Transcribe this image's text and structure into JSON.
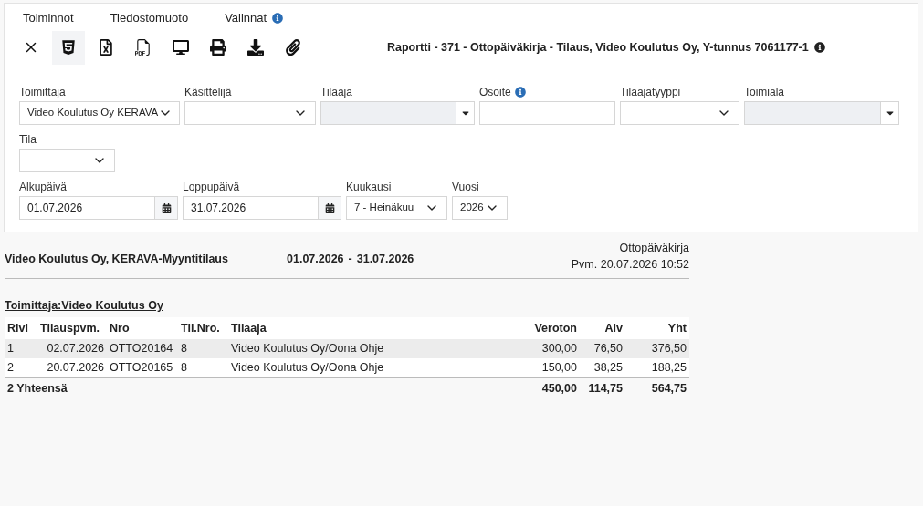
{
  "menu": [
    {
      "label": "Toiminnot",
      "info": false
    },
    {
      "label": "Tiedostomuoto",
      "info": false
    },
    {
      "label": "Valinnat",
      "info": true
    }
  ],
  "toolbar": [
    {
      "kind": "close",
      "selected": false
    },
    {
      "kind": "html",
      "selected": true
    },
    {
      "kind": "excel",
      "selected": false
    },
    {
      "kind": "pdf",
      "selected": false
    },
    {
      "kind": "screen",
      "selected": false
    },
    {
      "kind": "print",
      "selected": false
    },
    {
      "kind": "download",
      "selected": false
    },
    {
      "kind": "attach",
      "selected": false
    }
  ],
  "report_title": "Raportti - 371 - Ottopäiväkirja - Tilaus, Video Koulutus Oy, Y-tunnus 7061177-1",
  "filter_rows": [
    [
      {
        "label": "Toimittaja",
        "kind": "select",
        "value": "Video Koulutus Oy KERAVA",
        "info": false
      },
      {
        "label": "Käsittelijä",
        "kind": "select",
        "info": false
      },
      {
        "label": "Tilaaja",
        "kind": "combo",
        "info": false
      },
      {
        "label": "Osoite",
        "kind": "text",
        "info": true
      },
      {
        "label": "Tilaajatyyppi",
        "kind": "select",
        "info": false
      },
      {
        "label": "Toimiala",
        "kind": "combo",
        "info": false
      }
    ],
    [
      {
        "label": "Tila",
        "kind": "select",
        "info": false
      }
    ],
    [
      {
        "label": "Alkupäivä",
        "kind": "date",
        "value": "01.07.2026",
        "info": false
      },
      {
        "label": "Loppupäivä",
        "kind": "date",
        "value": "31.07.2026",
        "info": false
      },
      {
        "label": "Kuukausi",
        "kind": "select",
        "value": "7 - Heinäkuu",
        "info": false
      },
      {
        "label": "Vuosi",
        "kind": "select",
        "value": "2026",
        "info": false
      }
    ]
  ],
  "report": {
    "heading": "Video Koulutus Oy, KERAVA-Myyntitilaus",
    "period_start": "01.07.2026",
    "period_separator": "-",
    "period_end": "31.07.2026",
    "name": "Ottopäiväkirja",
    "printed": "Pvm. 20.07.2026 10:52",
    "group": "Toimittaja:Video Koulutus Oy",
    "columns": [
      "Rivi",
      "Tilauspvm.",
      "Nro",
      "Til.Nro.",
      "Tilaaja",
      "Veroton",
      "Alv",
      "Yht"
    ],
    "rows": [
      {
        "cells": [
          "1",
          "02.07.2026",
          "OTTO20164",
          "8",
          "Video Koulutus Oy/Oona Ohje",
          "300,00",
          "76,50",
          "376,50"
        ],
        "selected": true
      },
      {
        "cells": [
          "2",
          "20.07.2026",
          "OTTO20165",
          "8",
          "Video Koulutus Oy/Oona Ohje",
          "150,00",
          "38,25",
          "188,25"
        ],
        "selected": false
      }
    ],
    "total": {
      "label": "2 Yhteensä",
      "values": [
        "450,00",
        "114,75",
        "564,75"
      ]
    }
  }
}
